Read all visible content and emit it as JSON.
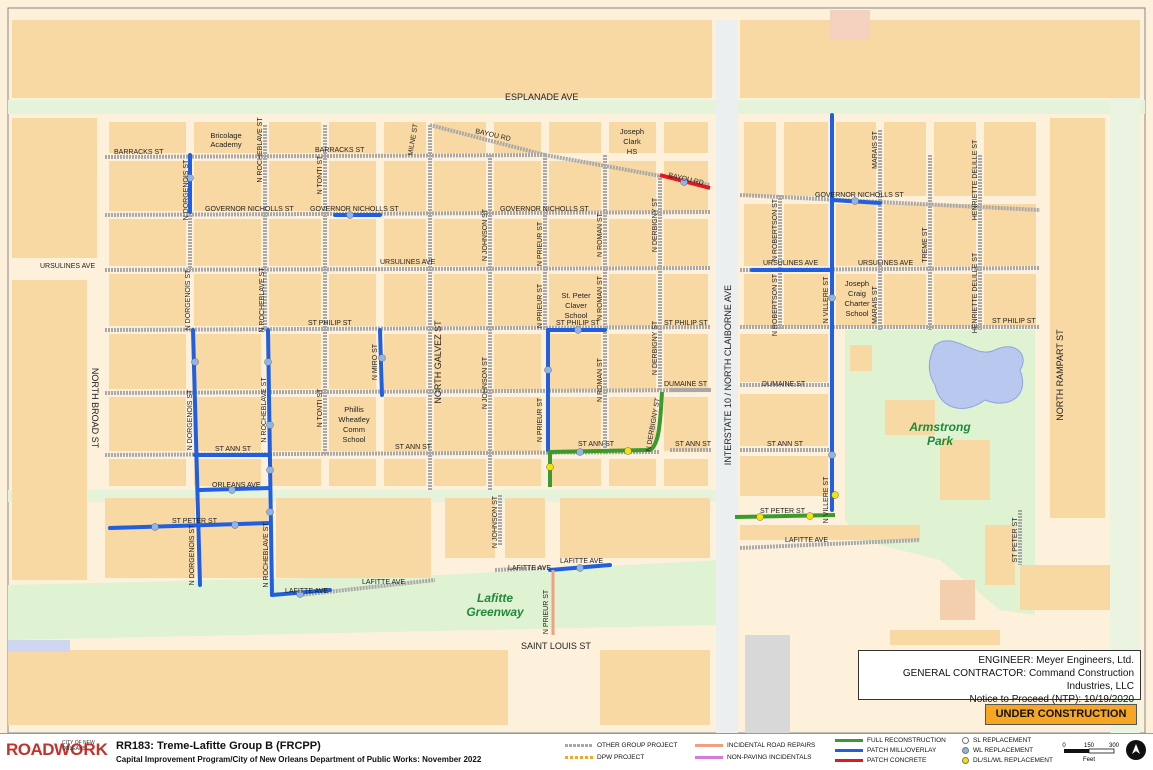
{
  "map": {
    "streets": {
      "esplanade": "ESPLANADE AVE",
      "bayou_rd_1": "BAYOU RD",
      "bayou_rd_2": "BAYOU RD",
      "barracks": "BARRACKS ST",
      "barracks_2": "BARRACKS ST",
      "gov_nicholls_1": "GOVERNOR NICHOLLS ST",
      "gov_nicholls_2": "GOVERNOR NICHOLLS ST",
      "gov_nicholls_3": "GOVERNOR NICHOLLS ST",
      "gov_nicholls_4": "GOVERNOR NICHOLLS ST",
      "ursulines_1": "URSULINES AVE",
      "ursulines_2": "URSULINES AVE",
      "ursulines_3": "URSULINES AVE",
      "ursulines_4": "URSULINES AVE",
      "st_philip_1": "ST PHILIP ST",
      "st_philip_2": "ST PHILIP ST",
      "st_philip_3": "ST PHILIP ST",
      "st_philip_4": "ST PHILIP ST",
      "dumaine_1": "DUMAINE ST",
      "dumaine_2": "DUMAINE ST",
      "st_ann_1": "ST ANN ST",
      "st_ann_2": "ST ANN ST",
      "st_ann_3": "ST ANN ST",
      "st_ann_4": "ST ANN ST",
      "st_ann_5": "ST ANN ST",
      "orleans": "ORLEANS AVE",
      "st_peter_1": "ST PETER ST",
      "st_peter_2": "ST PETER ST",
      "st_peter_3": "ST PETER ST",
      "lafitte_1": "LAFITTE AVE",
      "lafitte_2": "LAFITTE AVE",
      "lafitte_3": "LAFITTE AVE",
      "lafitte_4": "LAFITTE AVE",
      "lafitte_5": "LAFITTE AVE",
      "saint_louis": "SAINT LOUIS ST",
      "north_broad": "NORTH BROAD ST",
      "north_galvez": "NORTH GALVEZ ST",
      "interstate": "INTERSTATE 10 / NORTH CLAIBORNE AVE",
      "north_rampart": "NORTH RAMPART ST",
      "n_dorgenois_1": "N DORGENOIS ST",
      "n_dorgenois_2": "N DORGENOIS ST",
      "n_dorgenois_3": "N DORGENOIS ST",
      "n_dorgenois_4": "N DORGENOIS ST",
      "n_rocheblave_1": "N ROCHEBLAVE ST",
      "n_rocheblave_2": "N ROCHEBLAVE ST",
      "n_rocheblave_3": "N ROCHEBLAVE ST",
      "n_rocheblave_4": "N ROCHEBLAVE ST",
      "n_tonti_1": "N TONTI ST",
      "n_tonti_2": "N TONTI ST",
      "n_miro": "N MIRO ST",
      "milne": "MILNE ST",
      "n_johnson_1": "N JOHNSON ST",
      "n_johnson_2": "N JOHNSON ST",
      "n_johnson_3": "N JOHNSON ST",
      "n_prieur_1": "N PRIEUR ST",
      "n_prieur_2": "N PRIEUR ST",
      "n_prieur_3": "N PRIEUR ST",
      "n_prieur_4": "N PRIEUR ST",
      "n_roman_1": "N ROMAN ST",
      "n_roman_2": "N ROMAN ST",
      "n_roman_3": "N ROMAN ST",
      "n_derbigny_1": "N DERBIGNY ST",
      "n_derbigny_2": "N DERBIGNY ST",
      "n_derbigny_3": "N DERBIGNY ST",
      "n_robertson_1": "N ROBERTSON ST",
      "n_robertson_2": "N ROBERTSON ST",
      "n_villere_1": "N VILLERE ST",
      "n_villere_2": "N VILLERE ST",
      "marais_1": "MARAIS ST",
      "marais_2": "MARAIS ST",
      "treme": "TREME ST",
      "henriette_1": "HENRIETTE DELILLE ST",
      "henriette_2": "HENRIETTE DELILLE ST",
      "henriette_3": "HENRIETTE DELILLE ST",
      "st_peter_right": "ST PETER ST"
    },
    "places": {
      "bricolage": [
        "Bricolage",
        "Academy"
      ],
      "joseph_clark": [
        "Joseph",
        "Clark",
        "HS"
      ],
      "st_peter_claver": [
        "St. Peter",
        "Claver",
        "School"
      ],
      "joseph_craig": [
        "Joseph",
        "Craig",
        "Charter",
        "School"
      ],
      "phillis_wheatley": [
        "Phillis",
        "Wheatley",
        "Comm",
        "School"
      ],
      "armstrong_park": [
        "Armstrong",
        "Park"
      ],
      "lafitte_greenway": [
        "Lafitte",
        "Greenway"
      ]
    }
  },
  "info": {
    "engineer": "ENGINEER:  Meyer Engineers, Ltd.",
    "contractor": "GENERAL CONTRACTOR:  Command Construction Industries, LLC",
    "ntp": "Notice to Proceed (NTP):  10/19/2020",
    "status": "UNDER CONSTRUCTION"
  },
  "footer": {
    "logo_road": "ROAD",
    "logo_work": "WORK",
    "logo_city": "CITY OF NEW ORLEANS",
    "title": "RR183:  Treme-Lafitte Group B (FRCPP)",
    "subtitle": "Capital Improvement Program/City of New Orleans Department of Public Works:  November 2022",
    "legend": {
      "other_group": "OTHER GROUP PROJECT",
      "dpw": "DPW PROJECT",
      "incidental": "INCIDENTAL ROAD REPAIRS",
      "non_paving": "NON-PAVING INCIDENTALS",
      "full_recon": "FULL RECONSTRUCTION",
      "patch_mill": "PATCH MILL/OVERLAY",
      "patch_concrete": "PATCH CONCRETE",
      "sl": "SL REPLACEMENT",
      "wl": "WL REPLACEMENT",
      "dl": "DL/SL/WL REPLACEMENT"
    },
    "scale": [
      "0",
      "150",
      "300"
    ],
    "scale_unit": "Feet"
  },
  "colors": {
    "block": "#f8d9a4",
    "street": "#fdf1dc",
    "park": "#dff2d2",
    "mill": "#1f5fe0",
    "full": "#3a9a2c",
    "concrete": "#e1191e",
    "other": "#a8a8a8",
    "incidental": "#f0a080",
    "sl_dot": "#ffffff",
    "wl_dot": "#8fb5e8",
    "dl_dot": "#f4e400"
  }
}
